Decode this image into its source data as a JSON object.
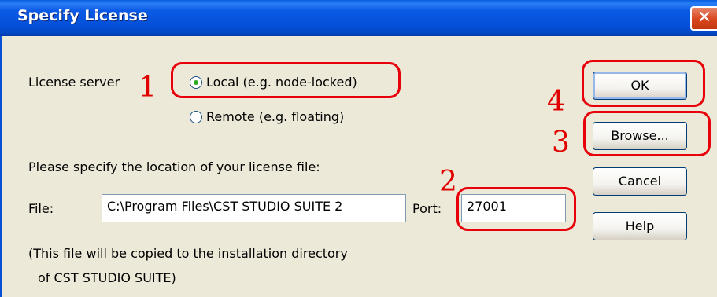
{
  "dialog": {
    "title": "Specify License",
    "close_glyph": "✕"
  },
  "license_server": {
    "label": "License server",
    "options": [
      {
        "label": "Local (e.g. node-locked)",
        "selected": true
      },
      {
        "label": "Remote (e.g. floating)",
        "selected": false
      }
    ]
  },
  "file_section": {
    "prompt": "Please specify the location of your license file:",
    "file_label": "File:",
    "file_value": "C:\\Program Files\\CST STUDIO SUITE 2",
    "port_label": "Port:",
    "port_value": "27001",
    "note_line1": "(This file will be copied to the installation directory",
    "note_line2": "of CST STUDIO SUITE)"
  },
  "buttons": {
    "ok": "OK",
    "browse": "Browse...",
    "cancel": "Cancel",
    "help": "Help"
  },
  "annotations": {
    "n1": "1",
    "n2": "2",
    "n3": "3",
    "n4": "4",
    "color": "#e00000"
  }
}
